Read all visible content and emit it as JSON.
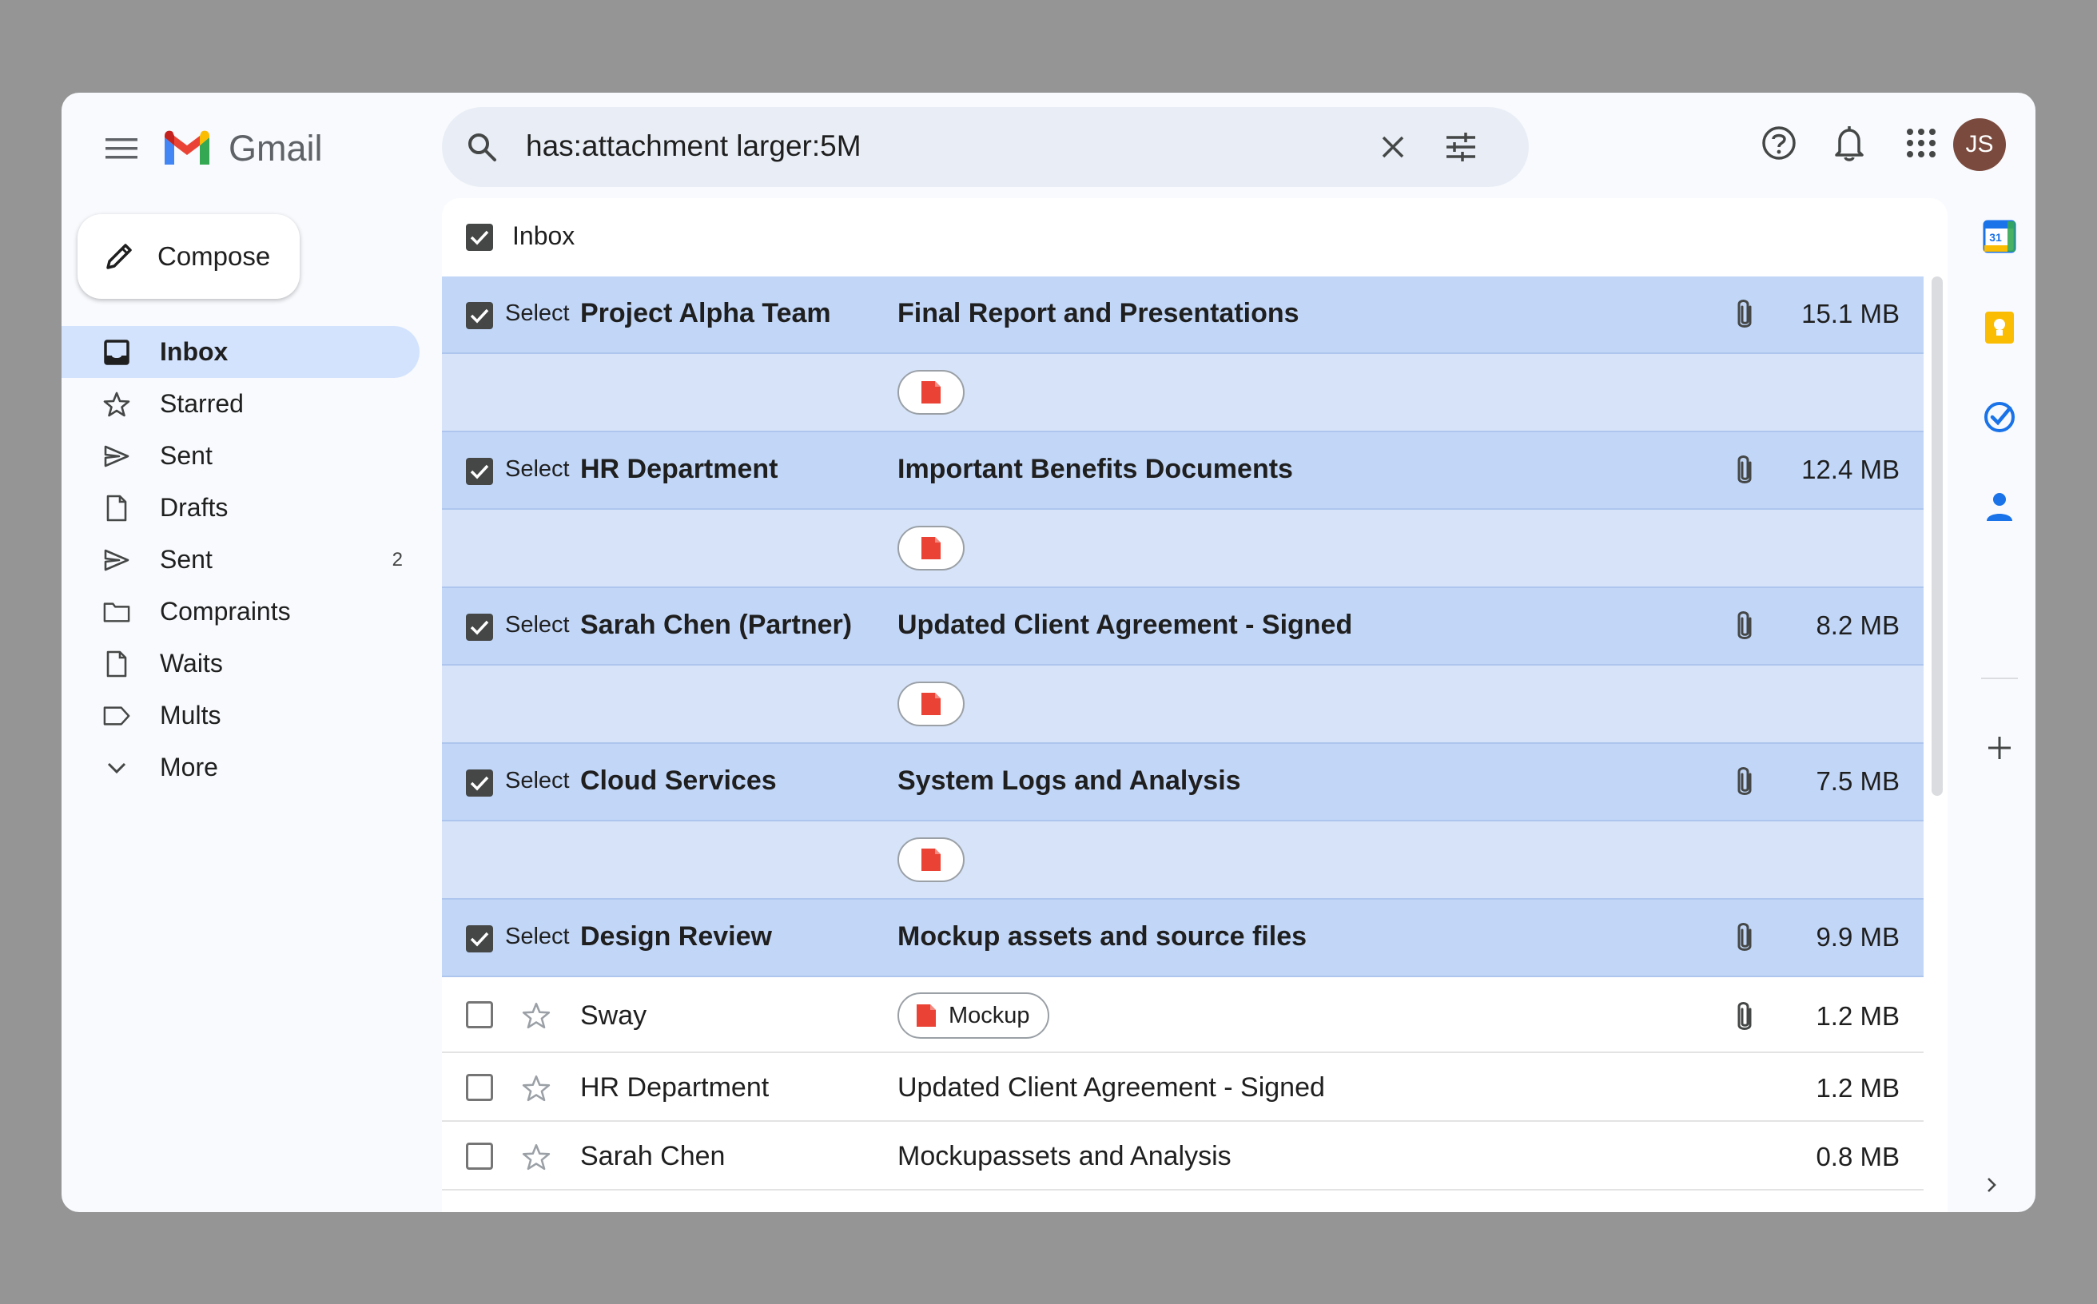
{
  "app": {
    "name": "Gmail"
  },
  "search": {
    "value": "has:attachment larger:5M"
  },
  "user": {
    "initials": "JS"
  },
  "compose": {
    "label": "Compose"
  },
  "nav": [
    {
      "label": "Inbox",
      "icon": "inbox-icon",
      "active": true
    },
    {
      "label": "Starred",
      "icon": "star-icon"
    },
    {
      "label": "Sent",
      "icon": "send-icon"
    },
    {
      "label": "Drafts",
      "icon": "file-icon"
    },
    {
      "label": "Sent",
      "icon": "send-icon",
      "count": "2"
    },
    {
      "label": "Compraints",
      "icon": "folder-icon"
    },
    {
      "label": "Waits",
      "icon": "file-icon"
    },
    {
      "label": "Mults",
      "icon": "label-icon"
    },
    {
      "label": "More",
      "icon": "chevron-down-icon"
    }
  ],
  "list": {
    "header": "Inbox",
    "select_text": "Select",
    "selected_rows": [
      {
        "sender": "Project Alpha Team",
        "subject": "Final Report and Presentations",
        "size": "15.1 MB"
      },
      {
        "sender": "HR Department",
        "subject": "Important Benefits Documents",
        "size": "12.4 MB"
      },
      {
        "sender": "Sarah Chen (Partner)",
        "subject": "Updated Client Agreement - Signed",
        "size": "8.2 MB"
      },
      {
        "sender": "Cloud Services",
        "subject": "System Logs and Analysis",
        "size": "7.5 MB"
      },
      {
        "sender": "Design Review",
        "subject": "Mockup assets and source files",
        "size": "9.9 MB"
      }
    ],
    "plain_rows": [
      {
        "sender": "Sway",
        "chip": "Mockup",
        "size": "1.2 MB"
      },
      {
        "sender": "HR Department",
        "subject": "Updated Client Agreement - Signed",
        "size": "1.2 MB"
      },
      {
        "sender": "Sarah Chen",
        "subject": "Mockupassets and Analysis",
        "size": "0.8 MB"
      }
    ]
  },
  "side_panel": {
    "calendar_day": "31"
  },
  "colors": {
    "accent": "#0b57d0",
    "selected_row": "#c2d7f8",
    "pdf_red": "#ea4335",
    "avatar": "#7b4a3e"
  }
}
